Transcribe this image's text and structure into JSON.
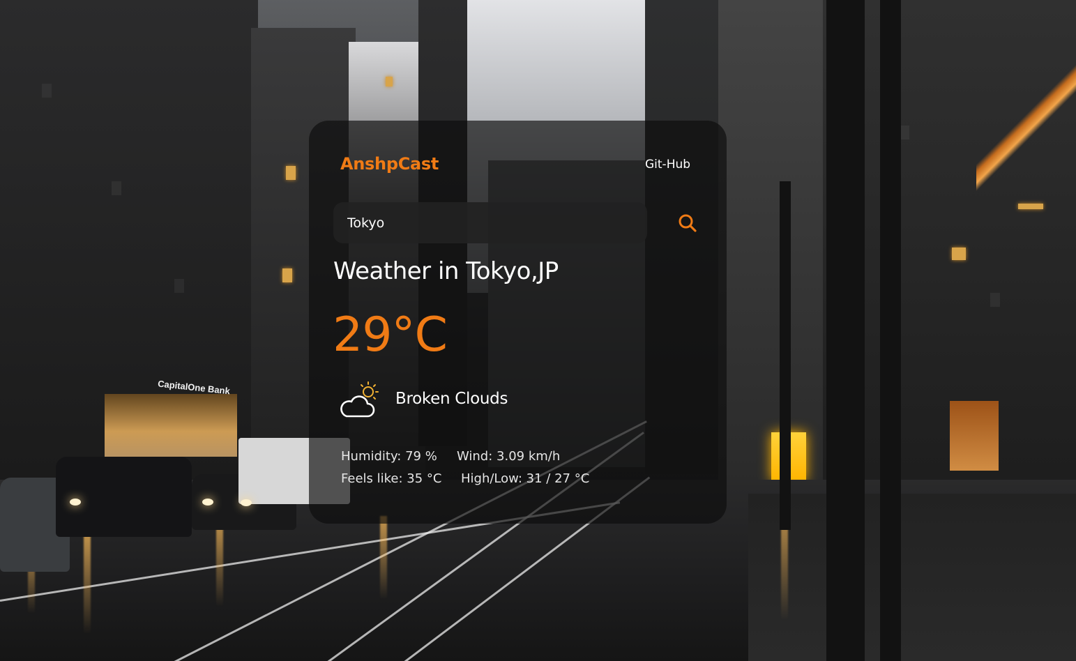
{
  "app": {
    "brand": "AnshpCast",
    "github_link": "Git-Hub"
  },
  "search": {
    "value": "Tokyo",
    "placeholder": "",
    "button_icon": "search-icon"
  },
  "weather": {
    "title": "Weather in Tokyo,JP",
    "temperature": "29°C",
    "condition": "Broken Clouds",
    "condition_icon": "partly-cloudy-icon",
    "humidity": "Humidity: 79 %",
    "wind": "Wind: 3.09 km/h",
    "feels_like": "Feels like: 35 °C",
    "high_low": "High/Low: 31 / 27 °C"
  },
  "background": {
    "scene": "rainy-city-street",
    "sign_text": "CapitalOne Bank"
  },
  "colors": {
    "accent": "#f07b15",
    "card_bg": "rgba(12,12,12,0.66)",
    "input_bg": "#222222",
    "text": "#ffffff"
  }
}
